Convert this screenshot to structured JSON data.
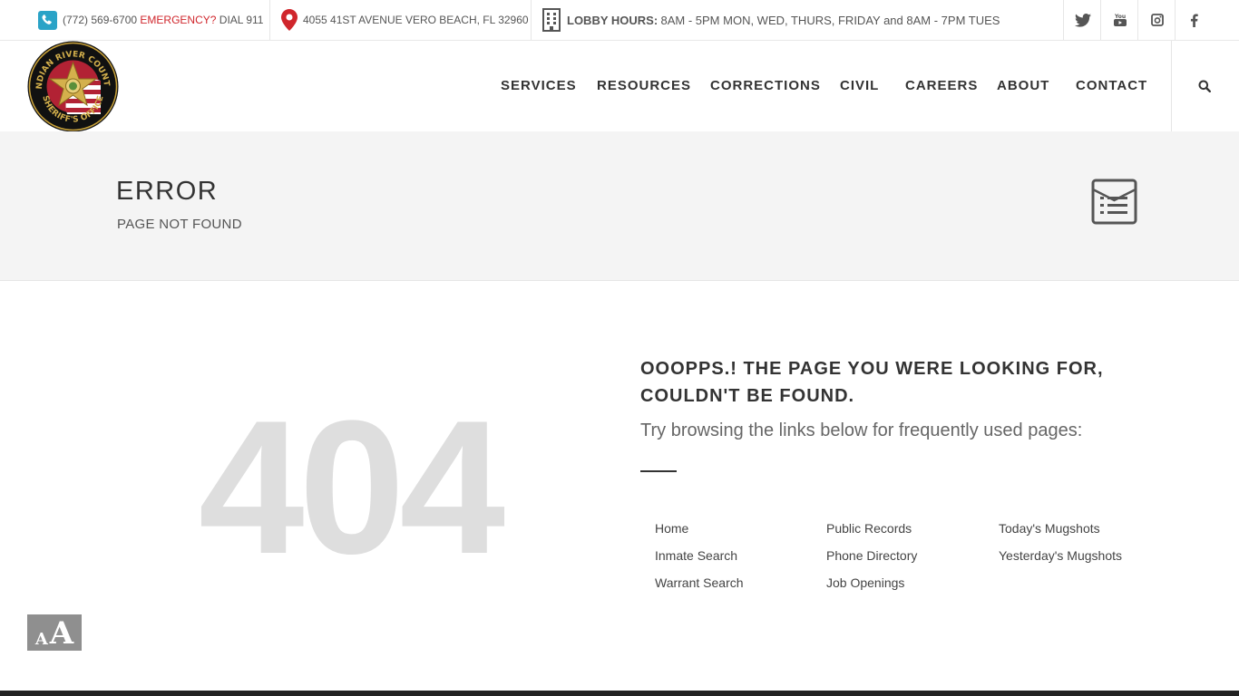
{
  "topbar": {
    "phone": "(772) 569-6700",
    "emergency_label": "EMERGENCY?",
    "emergency_text": "DIAL 911",
    "address": "4055 41ST AVENUE VERO BEACH, FL 32960",
    "hours_label": "LOBBY HOURS:",
    "hours_text": "8AM - 5PM MON, WED, THURS, FRIDAY and 8AM - 7PM TUES",
    "social": [
      "twitter-icon",
      "youtube-icon",
      "instagram-icon",
      "facebook-icon"
    ]
  },
  "logo": {
    "org_top": "INDIAN RIVER COUNTY",
    "org_bottom": "SHERIFF'S OFFICE"
  },
  "nav": {
    "items": [
      "SERVICES",
      "RESOURCES",
      "CORRECTIONS",
      "CIVIL",
      "CAREERS",
      "ABOUT",
      "CONTACT"
    ]
  },
  "title": {
    "heading": "ERROR",
    "subheading": "PAGE NOT FOUND"
  },
  "error": {
    "code": "404",
    "headline": "OOOPPS.! THE PAGE YOU WERE LOOKING FOR, COULDN'T BE FOUND.",
    "tagline": "Try browsing the links below for frequently used pages:"
  },
  "links": {
    "col1": [
      "Home",
      "Inmate Search",
      "Warrant Search"
    ],
    "col2": [
      "Public Records",
      "Phone Directory",
      "Job Openings"
    ],
    "col3": [
      "Today's Mugshots",
      "Yesterday's Mugshots"
    ]
  },
  "colors": {
    "accent_red": "#d0262c",
    "phone_icon": "#2aa3c7",
    "text_dark": "#333333",
    "number_grey": "#dedede"
  }
}
